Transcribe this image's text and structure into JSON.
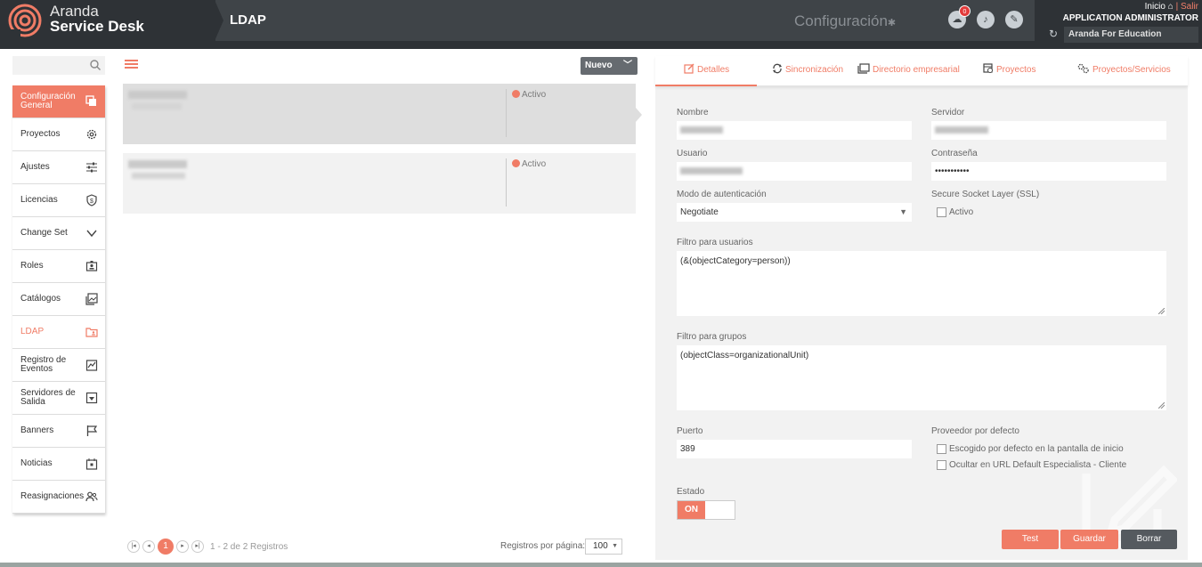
{
  "header": {
    "brand_top": "Aranda",
    "brand_bottom": "Service Desk",
    "page_title": "LDAP",
    "section_title": "Configuración",
    "notification_count": "0",
    "inicio": "Inicio",
    "salir": "Salir",
    "role": "APPLICATION ADMINISTRATOR",
    "organization": "Aranda For Education"
  },
  "sidebar": {
    "items": [
      {
        "label": "Configuración General",
        "icon": "copy-icon"
      },
      {
        "label": "Proyectos",
        "icon": "gear-icon"
      },
      {
        "label": "Ajustes",
        "icon": "sliders-icon"
      },
      {
        "label": "Licencias",
        "icon": "shield-icon"
      },
      {
        "label": "Change Set",
        "icon": "chevron-down-icon"
      },
      {
        "label": "Roles",
        "icon": "id-badge-icon"
      },
      {
        "label": "Catálogos",
        "icon": "gallery-icon"
      },
      {
        "label": "LDAP",
        "icon": "folder-user-icon"
      },
      {
        "label": "Registro de Eventos",
        "icon": "chart-icon"
      },
      {
        "label": "Servidores de Salida",
        "icon": "download-box-icon"
      },
      {
        "label": "Banners",
        "icon": "flag-icon"
      },
      {
        "label": "Noticias",
        "icon": "calendar-icon"
      },
      {
        "label": "Reasignaciones",
        "icon": "users-icon"
      }
    ]
  },
  "list": {
    "new_button": "Nuevo",
    "items": [
      {
        "status": "Activo"
      },
      {
        "status": "Activo"
      }
    ],
    "pager": {
      "current_page": "1",
      "summary": "1 - 2 de 2 Registros",
      "per_page_label": "Registros por página:",
      "per_page_value": "100"
    }
  },
  "detail": {
    "tabs": [
      "Detalles",
      "Sincronización",
      "Directorio empresarial",
      "Proyectos",
      "Proyectos/Servicios"
    ],
    "fields": {
      "nombre_label": "Nombre",
      "servidor_label": "Servidor",
      "usuario_label": "Usuario",
      "contrasena_label": "Contraseña",
      "contrasena_value": "•••••••••••",
      "modo_label": "Modo de autenticación",
      "modo_value": "Negotiate",
      "ssl_label": "Secure Socket Layer (SSL)",
      "ssl_option": "Activo",
      "filtro_usuarios_label": "Filtro para usuarios",
      "filtro_usuarios_value": "(&(objectCategory=person))",
      "filtro_grupos_label": "Filtro para grupos",
      "filtro_grupos_value": "(objectClass=organizationalUnit)",
      "puerto_label": "Puerto",
      "puerto_value": "389",
      "proveedor_label": "Proveedor por defecto",
      "proveedor_opt1": "Escogido por defecto en la pantalla de inicio",
      "proveedor_opt2": "Ocultar en URL Default Especialista - Cliente",
      "estado_label": "Estado",
      "estado_value": "ON"
    },
    "buttons": {
      "test": "Test",
      "guardar": "Guardar",
      "borrar": "Borrar"
    }
  },
  "colors": {
    "accent": "#f07c66",
    "header_bg": "#2e3236",
    "panel_bg": "#f2f2f2"
  }
}
